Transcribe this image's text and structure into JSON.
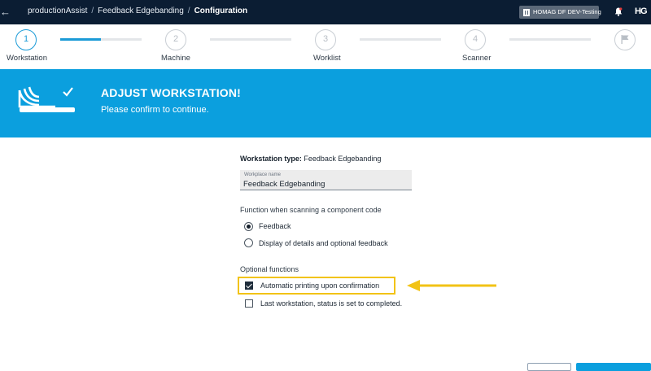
{
  "topbar": {
    "breadcrumb": [
      "productionAssist",
      "Feedback Edgebanding",
      "Configuration"
    ],
    "tenant_label": "HOMAG DF DEV-Testing",
    "logo_text": "HG"
  },
  "stepper": {
    "steps": [
      {
        "number": "1",
        "label": "Workstation",
        "active": true
      },
      {
        "number": "2",
        "label": "Machine",
        "active": false
      },
      {
        "number": "3",
        "label": "Worklist",
        "active": false
      },
      {
        "number": "4",
        "label": "Scanner",
        "active": false
      },
      {
        "number": "",
        "label": "",
        "icon": "flag-icon",
        "active": false
      }
    ],
    "first_segment_progress": 0.5
  },
  "banner": {
    "title": "ADJUST WORKSTATION!",
    "subtitle": "Please confirm to continue.",
    "color": "#0b9fde"
  },
  "form": {
    "workstation_type_label": "Workstation type:",
    "workstation_type_value": "Feedback Edgebanding",
    "workplace_name_label": "Workplace name",
    "workplace_name_value": "Feedback Edgebanding",
    "scan_function_label": "Function when scanning a component code",
    "scan_options": [
      {
        "label": "Feedback",
        "selected": true
      },
      {
        "label": "Display of details and optional feedback",
        "selected": false
      }
    ],
    "optional_label": "Optional functions",
    "optional_options": [
      {
        "label": "Automatic printing upon confirmation",
        "checked": true
      },
      {
        "label": "Last workstation, status is set to completed.",
        "checked": false
      }
    ]
  },
  "colors": {
    "topbar": "#0b1d33",
    "accent": "#1b9bd7",
    "highlight": "#f2c315"
  }
}
